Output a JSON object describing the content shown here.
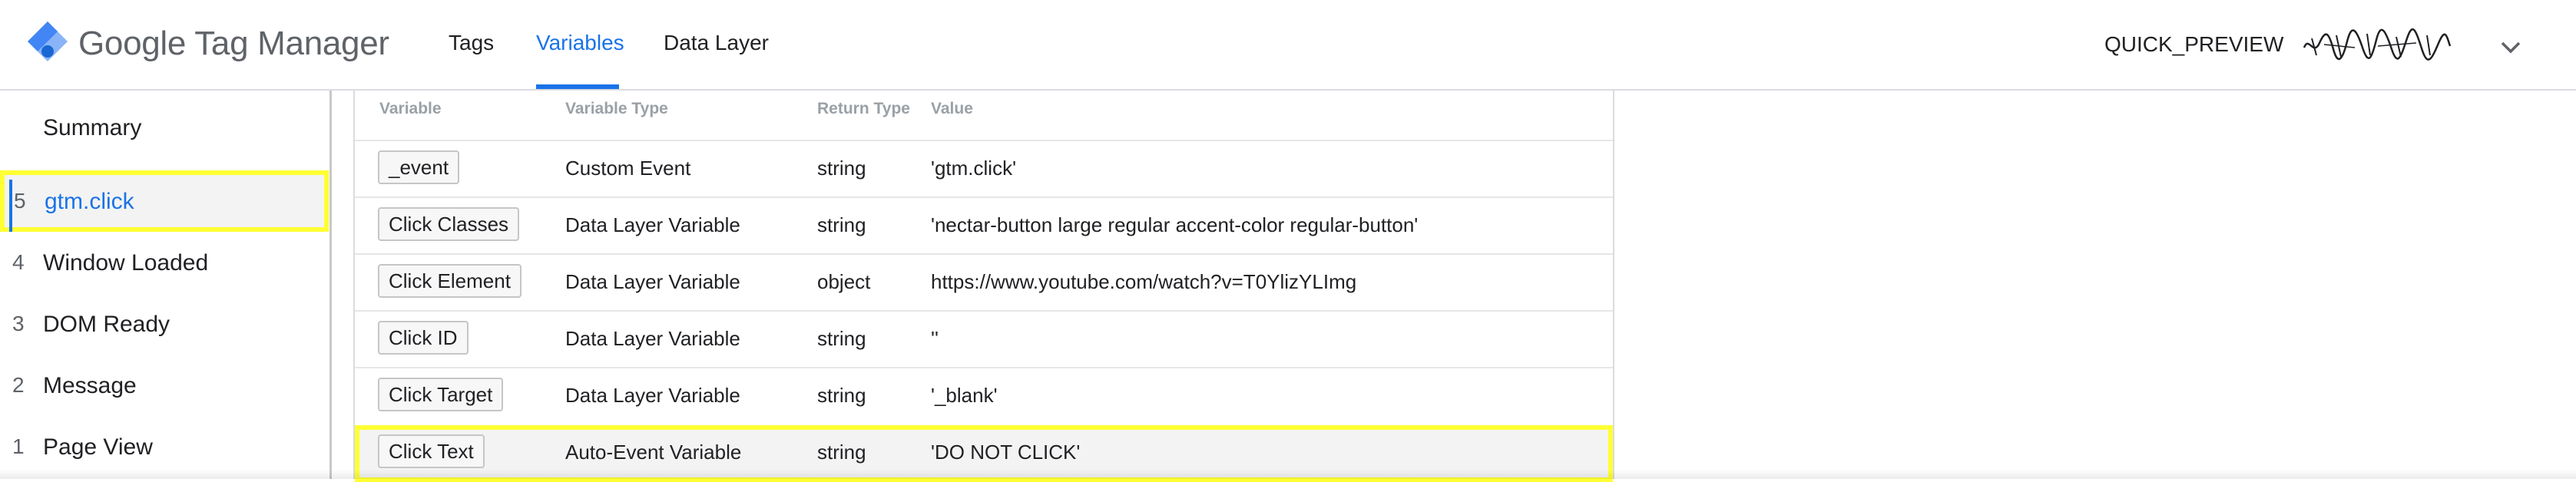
{
  "app": {
    "title": "Google Tag Manager",
    "brand_color": "#1a73e8",
    "logo_icon": "gtm-diamond-icon"
  },
  "nav": {
    "tabs": [
      {
        "label": "Tags",
        "active": false
      },
      {
        "label": "Variables",
        "active": true
      },
      {
        "label": "Data Layer",
        "active": false
      }
    ]
  },
  "header": {
    "preview_label": "QUICK_PREVIEW",
    "account_icon": "signature-scribble",
    "menu_icon": "chevron-down-icon"
  },
  "sidebar": {
    "summary_label": "Summary",
    "events": [
      {
        "number": "5",
        "label": "gtm.click",
        "selected": true
      },
      {
        "number": "4",
        "label": "Window Loaded",
        "selected": false
      },
      {
        "number": "3",
        "label": "DOM Ready",
        "selected": false
      },
      {
        "number": "2",
        "label": "Message",
        "selected": false
      },
      {
        "number": "1",
        "label": "Page View",
        "selected": false
      }
    ]
  },
  "table": {
    "columns": [
      "Variable",
      "Variable Type",
      "Return Type",
      "Value"
    ],
    "rows": [
      {
        "variable": "_event",
        "type": "Custom Event",
        "return_type": "string",
        "value": "'gtm.click'"
      },
      {
        "variable": "Click Classes",
        "type": "Data Layer Variable",
        "return_type": "string",
        "value": "'nectar-button large regular accent-color  regular-button'"
      },
      {
        "variable": "Click Element",
        "type": "Data Layer Variable",
        "return_type": "object",
        "value": "https://www.youtube.com/watch?v=T0YlizYLImg"
      },
      {
        "variable": "Click ID",
        "type": "Data Layer Variable",
        "return_type": "string",
        "value": "''"
      },
      {
        "variable": "Click Target",
        "type": "Data Layer Variable",
        "return_type": "string",
        "value": "'_blank'"
      },
      {
        "variable": "Click Text",
        "type": "Auto-Event Variable",
        "return_type": "string",
        "value": "'DO NOT CLICK'",
        "highlighted": true
      }
    ]
  },
  "highlight_color": "#ffff33"
}
